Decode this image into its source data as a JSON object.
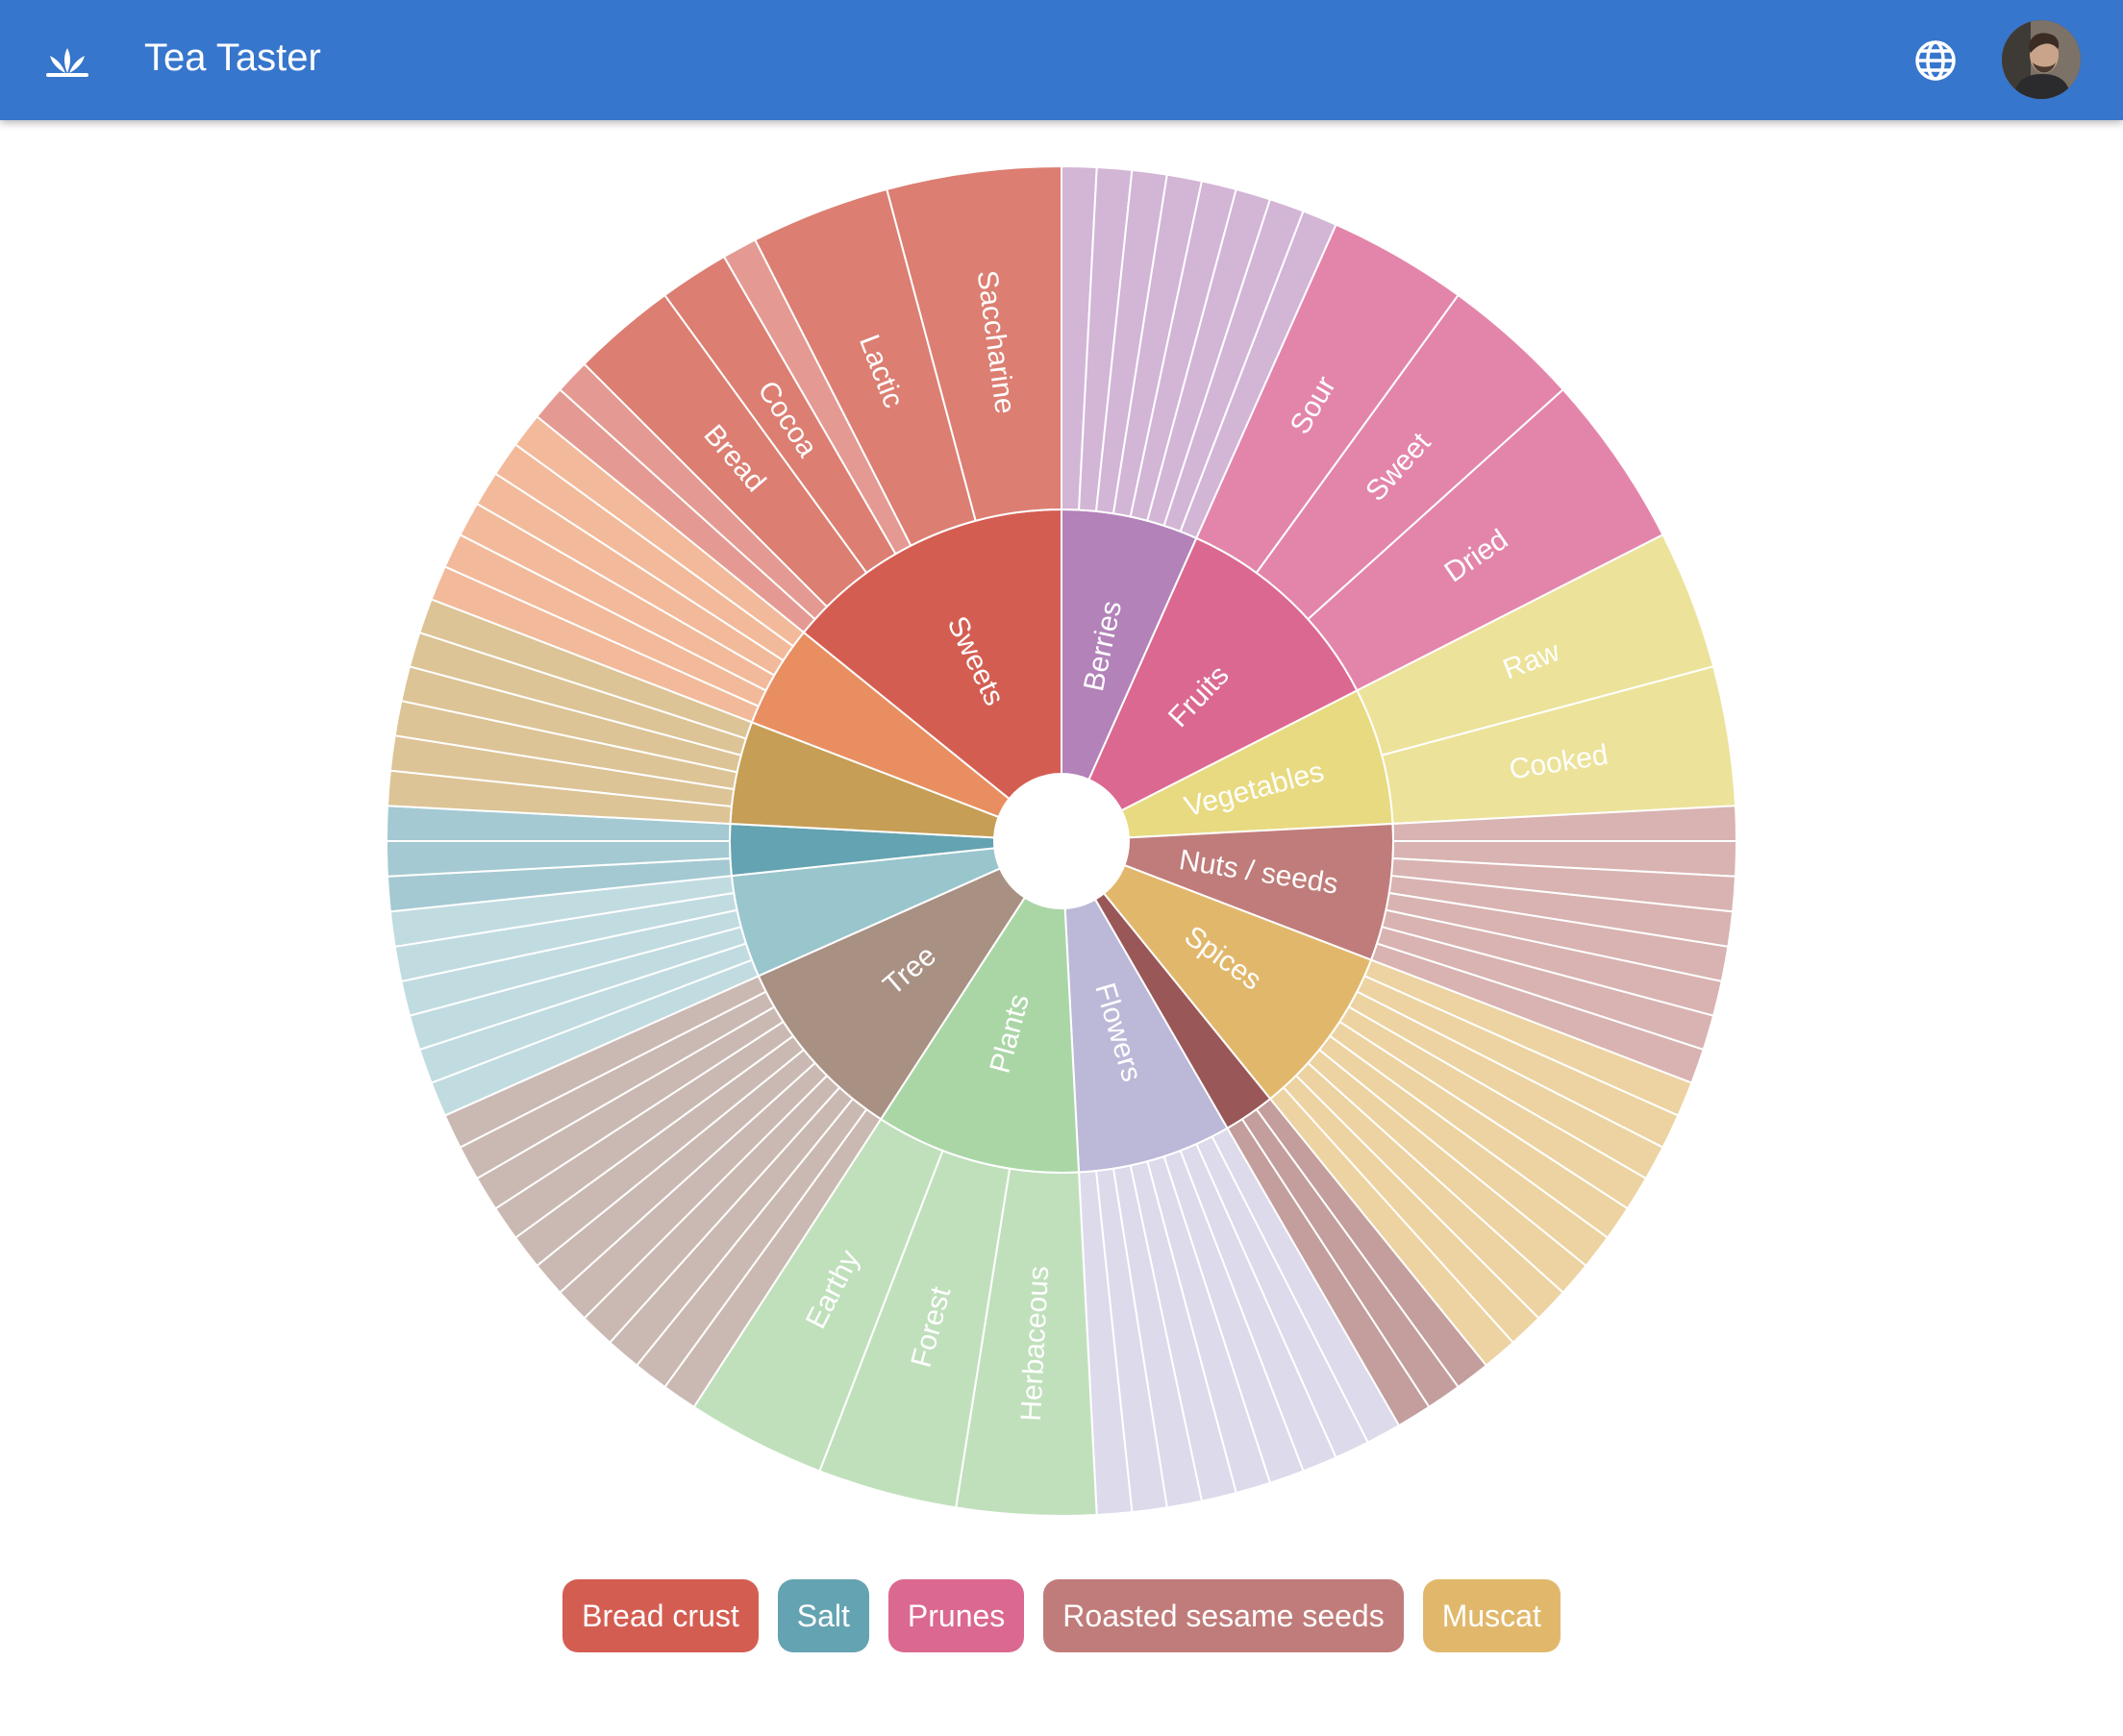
{
  "header": {
    "title": "Tea Taster",
    "colors": {
      "bar": "#3676cc",
      "text": "#ffffff"
    },
    "icons": {
      "logo": "sprout-logo-icon",
      "language": "globe-icon",
      "account": "avatar"
    }
  },
  "wheel": {
    "categories": [
      {
        "label": "Berries",
        "color": "#b282b9",
        "outer_color": "#d3b5d6",
        "weight": 8,
        "children": []
      },
      {
        "label": "Fruits",
        "color": "#db6890",
        "outer_color": "#e385aa",
        "weight": 13,
        "children": [
          {
            "label": "Sour",
            "weight": 4
          },
          {
            "label": "Sweet",
            "weight": 4
          },
          {
            "label": "Dried",
            "weight": 5
          }
        ]
      },
      {
        "label": "Vegetables",
        "color": "#e8da80",
        "outer_color": "#ece29a",
        "weight": 8,
        "children": [
          {
            "label": "Raw",
            "weight": 4
          },
          {
            "label": "Cooked",
            "weight": 4
          }
        ]
      },
      {
        "label": "Nuts / seeds",
        "color": "#c07c7a",
        "outer_color": "#d8b3b2",
        "weight": 8,
        "children": []
      },
      {
        "label": "Spices",
        "color": "#e1b86b",
        "outer_color": "#ecd3a1",
        "weight": 10,
        "children": []
      },
      {
        "label": "",
        "color": "#9a5758",
        "outer_color": "#c39e9c",
        "weight": 3,
        "children": []
      },
      {
        "label": "Flowers",
        "color": "#bcb8d8",
        "outer_color": "#dcdaeb",
        "weight": 9,
        "children": []
      },
      {
        "label": "Plants",
        "color": "#aad6a6",
        "outer_color": "#c0e0bc",
        "weight": 12,
        "children": [
          {
            "label": "Herbaceous",
            "weight": 4
          },
          {
            "label": "Forest",
            "weight": 4
          },
          {
            "label": "Earthy",
            "weight": 4
          }
        ]
      },
      {
        "label": "Tree",
        "color": "#a89083",
        "outer_color": "#cab9b2",
        "weight": 11,
        "children": []
      },
      {
        "label": "",
        "color": "#99c5cc",
        "outer_color": "#c1dce1",
        "weight": 6,
        "children": []
      },
      {
        "label": "",
        "color": "#64a3b1",
        "outer_color": "#a4c9d2",
        "weight": 3,
        "children": []
      },
      {
        "label": "",
        "color": "#c69e55",
        "outer_color": "#dcc496",
        "weight": 6,
        "children": []
      },
      {
        "label": "",
        "color": "#e98e60",
        "outer_color": "#f2ba9a",
        "weight": 6,
        "children": []
      },
      {
        "label": "Sweets",
        "color": "#d45d52",
        "outer_color": "#dc7e72",
        "weight": 17,
        "children": [
          {
            "label": "",
            "weight": 1,
            "pale": true
          },
          {
            "label": "",
            "weight": 1,
            "pale": true
          },
          {
            "label": "Bread",
            "weight": 3
          },
          {
            "label": "Cocoa",
            "weight": 2
          },
          {
            "label": "",
            "weight": 1,
            "pale": true
          },
          {
            "label": "Lactic",
            "weight": 4
          },
          {
            "label": "Saccharine",
            "weight": 5
          }
        ]
      }
    ],
    "pale_color": "#e49a92"
  },
  "chips": [
    {
      "label": "Bread crust",
      "color": "#d45d52"
    },
    {
      "label": "Salt",
      "color": "#64a3b1"
    },
    {
      "label": "Prunes",
      "color": "#db6890"
    },
    {
      "label": "Roasted sesame seeds",
      "color": "#c07c7a"
    },
    {
      "label": "Muscat",
      "color": "#e1b86b"
    }
  ]
}
